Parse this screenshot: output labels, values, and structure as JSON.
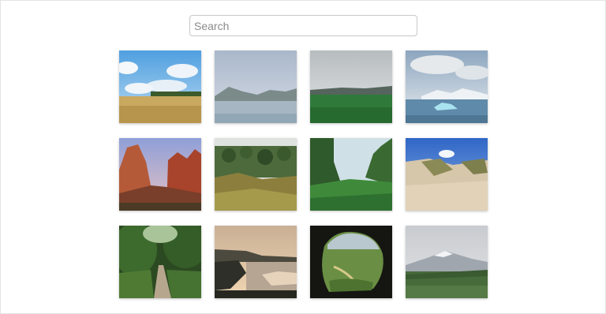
{
  "search": {
    "placeholder": "Search",
    "value": ""
  },
  "gallery": {
    "photos": [
      {
        "name": "photo-field-blue-sky"
      },
      {
        "name": "photo-lake-misty-hills"
      },
      {
        "name": "photo-green-meadow-coast"
      },
      {
        "name": "photo-glacier-icebergs"
      },
      {
        "name": "photo-red-canyon-cliffs"
      },
      {
        "name": "photo-forest-hillside"
      },
      {
        "name": "photo-green-valley-rocks"
      },
      {
        "name": "photo-sand-dunes-grass"
      },
      {
        "name": "photo-forest-path"
      },
      {
        "name": "photo-sunset-coastline"
      },
      {
        "name": "photo-cave-view-valley"
      },
      {
        "name": "photo-snowy-mountain-field"
      }
    ]
  }
}
